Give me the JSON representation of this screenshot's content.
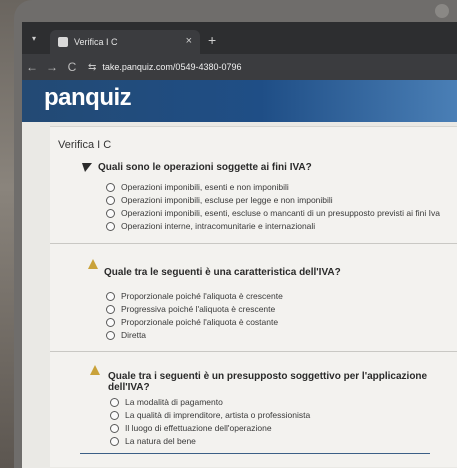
{
  "browser": {
    "tab_title": "Verifica I C",
    "tab_close": "×",
    "new_tab": "+",
    "tab_list": "▾",
    "back": "←",
    "forward": "→",
    "reload": "C",
    "site_settings": "⇆",
    "url": "take.panquiz.com/0549-4380-0796"
  },
  "app": {
    "logo": "panquiz",
    "page_title": "Verifica I C"
  },
  "questions": [
    {
      "text": "Quali sono le operazioni soggette ai fini IVA?",
      "options": [
        "Operazioni imponibili, esenti e non imponibili",
        "Operazioni imponibili, escluse per legge e non imponibili",
        "Operazioni imponibili, esenti, escluse o mancanti di un presupposto previsti ai fini Iva",
        "Operazioni interne, intracomunitarie e internazionali"
      ]
    },
    {
      "text": "Quale tra le seguenti è una caratteristica dell'IVA?",
      "options": [
        "Proporzionale poiché l'aliquota è crescente",
        "Progressiva poiché l'aliquota è crescente",
        "Proporzionale poiché l'aliquota è costante",
        "Diretta"
      ]
    },
    {
      "text": "Quale tra i seguenti è un presupposto soggettivo per l'applicazione dell'IVA?",
      "options": [
        "La modalità di pagamento",
        "La qualità di imprenditore, artista o professionista",
        "Il luogo di effettuazione dell'operazione",
        "La natura del bene"
      ]
    }
  ],
  "colors": {
    "header": "#1f4e86",
    "page_bg": "#f3f2ef",
    "browser_dark": "#2d2e30"
  }
}
